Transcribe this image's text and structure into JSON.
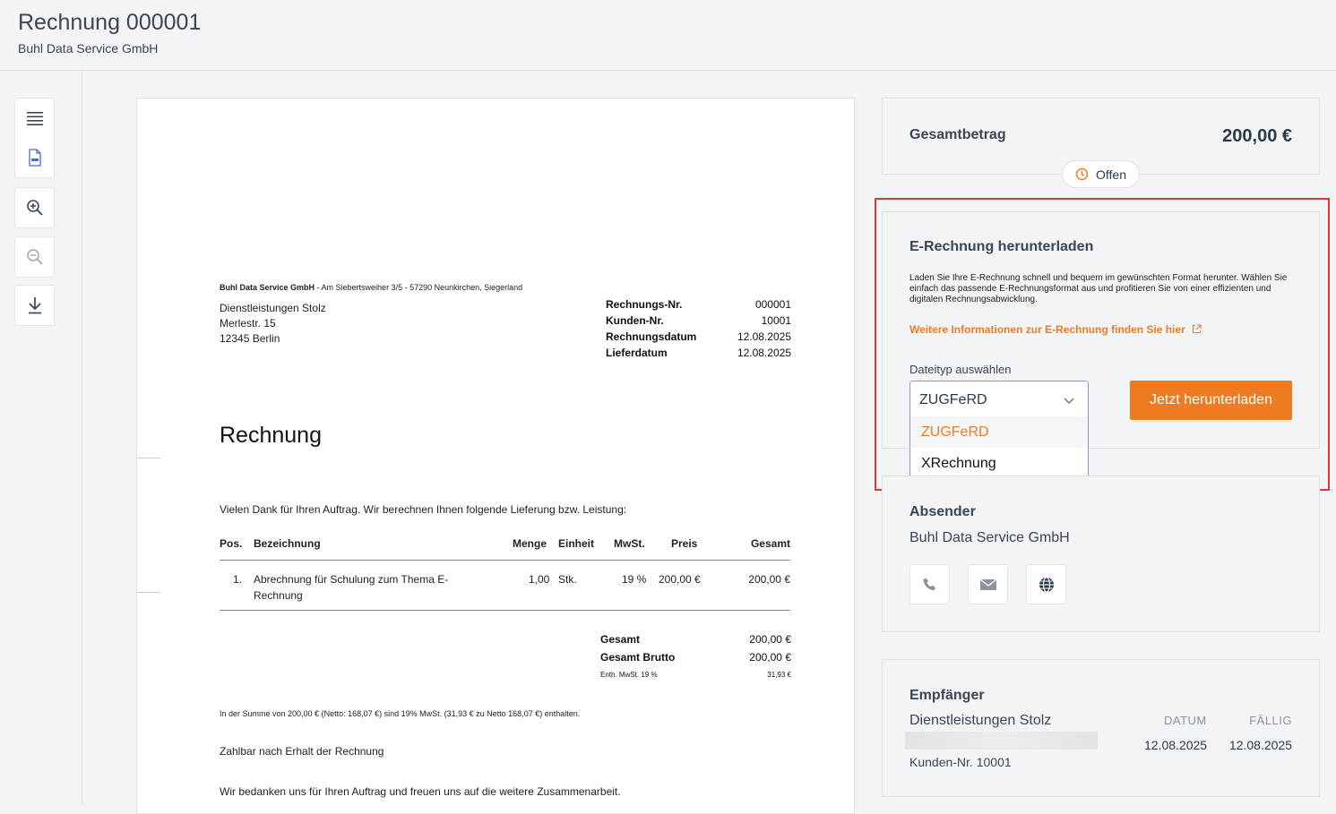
{
  "header": {
    "title": "Rechnung 000001",
    "subtitle": "Buhl Data Service GmbH"
  },
  "toolbar": {
    "icons": [
      "menu-icon",
      "pdf-file-icon",
      "zoom-in-icon",
      "zoom-out-icon",
      "download-icon"
    ]
  },
  "document": {
    "sender_name": "Buhl Data Service GmbH",
    "sender_rest": " - Am Siebertsweiher 3/5 - 57290 Neunkirchen, Siegerland",
    "recipient": [
      "Dienstleistungen Stolz",
      "Merlestr. 15",
      "12345 Berlin"
    ],
    "meta": [
      {
        "label": "Rechnungs-Nr.",
        "value": "000001"
      },
      {
        "label": "Kunden-Nr.",
        "value": "10001"
      },
      {
        "label": "Rechnungsdatum",
        "value": "12.08.2025"
      },
      {
        "label": "Lieferdatum",
        "value": "12.08.2025"
      }
    ],
    "heading": "Rechnung",
    "intro": "Vielen Dank für Ihren Auftrag. Wir berechnen Ihnen folgende Lieferung bzw. Leistung:",
    "table": {
      "headers": [
        "Pos.",
        "Bezeichnung",
        "Menge",
        "Einheit",
        "MwSt.",
        "Preis",
        "Gesamt"
      ],
      "row": {
        "pos": "1.",
        "desc_line1": "Abrechnung für Schulung zum Thema E-",
        "desc_line2": "Rechnung",
        "menge": "1,00",
        "einheit": "Stk.",
        "mwst": "19 %",
        "preis": "200,00 €",
        "gesamt": "200,00 €"
      }
    },
    "totals": [
      {
        "label": "Gesamt",
        "value": "200,00 €"
      },
      {
        "label": "Gesamt Brutto",
        "value": "200,00 €"
      }
    ],
    "tax_label": "Enth. MwSt. 19 %",
    "tax_value": "31,93 €",
    "note": "In der Summe von 200,00 € (Netto: 168,07 €) sind 19% MwSt. (31,93 € zu Netto 168,07 €) enthalten.",
    "payment": "Zahlbar nach Erhalt der Rechnung",
    "thanks": "Wir bedanken uns für Ihren Auftrag und freuen uns auf die weitere Zusammenarbeit."
  },
  "summary": {
    "total_label": "Gesamtbetrag",
    "total_value": "200,00 €",
    "status": "Offen"
  },
  "erechnung": {
    "heading": "E-Rechnung herunterladen",
    "description": "Laden Sie Ihre E-Rechnung schnell und bequem im gewünschten Format herunter. Wählen Sie einfach das passende E-Rechnungsformat aus und profitieren Sie von einer effizienten und digitalen Rechnungsabwicklung.",
    "link": "Weitere Informationen zur E-Rechnung finden Sie hier",
    "field_label": "Dateityp auswählen",
    "selected": "ZUGFeRD",
    "options": [
      "ZUGFeRD",
      "XRechnung"
    ],
    "button": "Jetzt herunterladen"
  },
  "absender": {
    "heading": "Absender",
    "name": "Buhl Data Service GmbH",
    "icons": [
      "phone-icon",
      "mail-icon",
      "globe-icon"
    ]
  },
  "empfaenger": {
    "heading": "Empfänger",
    "name": "Dienstleistungen Stolz",
    "kunden_nr": "Kunden-Nr. 10001",
    "datum_label": "DATUM",
    "datum_value": "12.08.2025",
    "faellig_label": "FÄLLIG",
    "faellig_value": "12.08.2025"
  },
  "colors": {
    "accent": "#ee7a22",
    "highlight": "#e0363c"
  }
}
